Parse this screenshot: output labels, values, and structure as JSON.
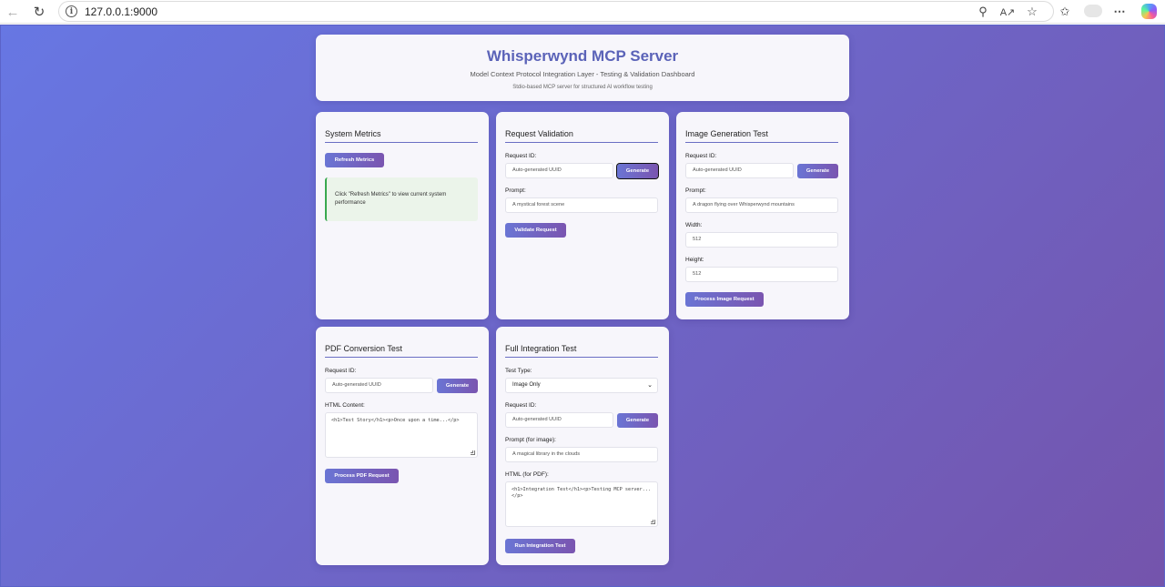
{
  "browser": {
    "url": "127.0.0.1:9000",
    "info_icon": "i"
  },
  "header": {
    "title": "Whisperwynd MCP Server",
    "subtitle": "Model Context Protocol Integration Layer - Testing & Validation Dashboard",
    "caption": "Stdio-based MCP server for structured AI workflow testing"
  },
  "system_metrics": {
    "title": "System Metrics",
    "refresh_label": "Refresh Metrics",
    "info_text": "Click \"Refresh Metrics\" to view current system performance"
  },
  "request_validation": {
    "title": "Request Validation",
    "request_id_label": "Request ID:",
    "request_id_placeholder": "Auto-generated UUID",
    "generate_label": "Generate",
    "prompt_label": "Prompt:",
    "prompt_value": "A mystical forest scene",
    "validate_label": "Validate Request"
  },
  "image_generation": {
    "title": "Image Generation Test",
    "request_id_label": "Request ID:",
    "request_id_placeholder": "Auto-generated UUID",
    "generate_label": "Generate",
    "prompt_label": "Prompt:",
    "prompt_value": "A dragon flying over Whisperwynd mountains",
    "width_label": "Width:",
    "width_value": "512",
    "height_label": "Height:",
    "height_value": "512",
    "process_label": "Process Image Request"
  },
  "pdf_conversion": {
    "title": "PDF Conversion Test",
    "request_id_label": "Request ID:",
    "request_id_placeholder": "Auto-generated UUID",
    "generate_label": "Generate",
    "html_label": "HTML Content:",
    "html_value": "<h1>Test Story</h1><p>Once upon a time...</p>",
    "process_label": "Process PDF Request"
  },
  "full_integration": {
    "title": "Full Integration Test",
    "test_type_label": "Test Type:",
    "test_type_value": "Image Only",
    "request_id_label": "Request ID:",
    "request_id_placeholder": "Auto-generated UUID",
    "generate_label": "Generate",
    "prompt_label": "Prompt (for image):",
    "prompt_value": "A magical library in the clouds",
    "html_label": "HTML (for PDF):",
    "html_value": "<h1>Integration Test</h1><p>Testing MCP server...</p>",
    "run_label": "Run Integration Test"
  },
  "colors": {
    "gradient_start": "#6777e3",
    "gradient_end": "#7454ac",
    "title": "#5b63b8",
    "info_border": "#39a84f"
  }
}
